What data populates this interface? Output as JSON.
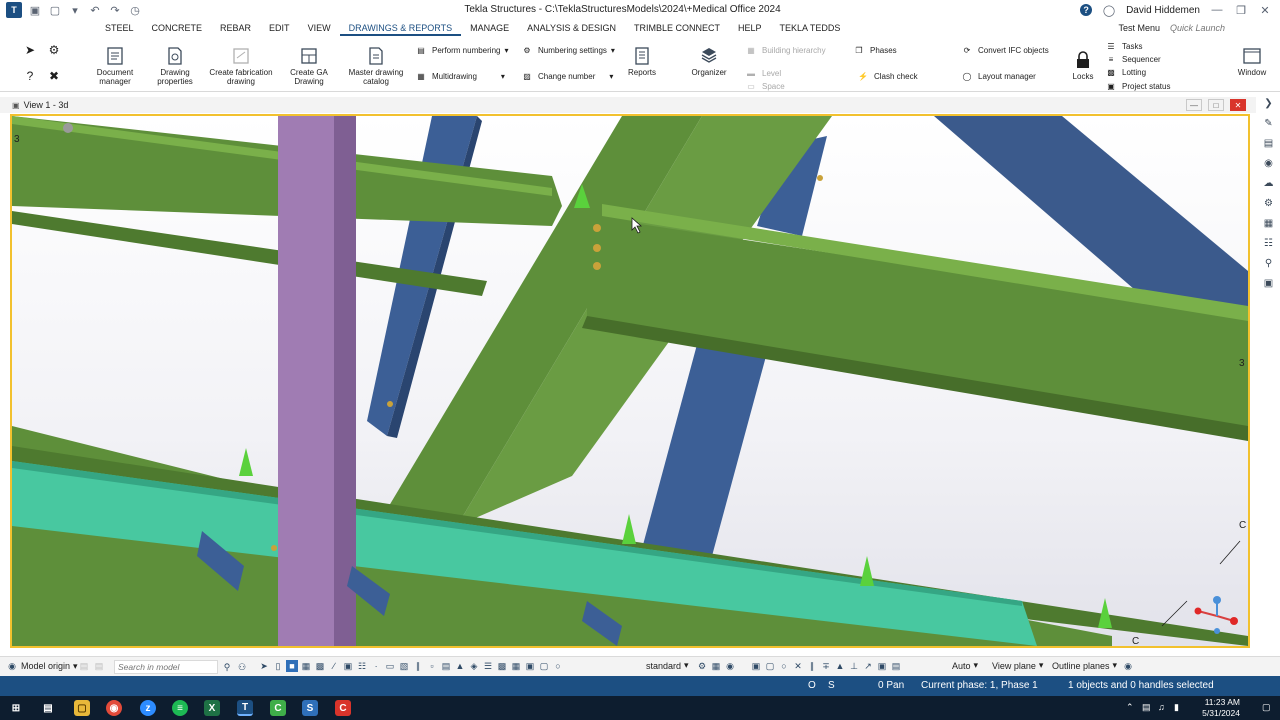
{
  "window": {
    "title": "Tekla Structures - C:\\TeklaStructuresModels\\2024\\+Medical Office 2024",
    "user": "David Hiddemen"
  },
  "menu": {
    "tabs": [
      "STEEL",
      "CONCRETE",
      "REBAR",
      "EDIT",
      "VIEW",
      "DRAWINGS & REPORTS",
      "MANAGE",
      "ANALYSIS & DESIGN",
      "TRIMBLE CONNECT",
      "HELP",
      "TEKLA TEDDS"
    ],
    "active_tab": "DRAWINGS & REPORTS",
    "test_menu": "Test Menu",
    "quick_launch_placeholder": "Quick Launch"
  },
  "ribbon": {
    "document_manager": "Document manager",
    "drawing_properties": "Drawing properties",
    "create_fabrication_drawing": "Create fabrication drawing",
    "create_ga_drawing": "Create GA Drawing",
    "master_drawing_catalog": "Master drawing catalog",
    "perform_numbering": "Perform numbering",
    "numbering_settings": "Numbering settings",
    "multidrawing": "Multidrawing",
    "change_number": "Change number",
    "reports": "Reports",
    "organizer": "Organizer",
    "building_hierarchy": "Building hierarchy",
    "level": "Level",
    "space": "Space",
    "phases": "Phases",
    "clash_check": "Clash check",
    "convert_ifc_objects": "Convert IFC objects",
    "layout_manager": "Layout manager",
    "locks": "Locks",
    "tasks": "Tasks",
    "sequencer": "Sequencer",
    "lotting": "Lotting",
    "project_status": "Project status",
    "window": "Window"
  },
  "view": {
    "title": "View 1 - 3d",
    "grid_labels": [
      "3",
      "3",
      "C",
      "C"
    ]
  },
  "bottom_toolbar": {
    "model_origin": "Model origin",
    "search_placeholder": "Search in model",
    "standard": "standard",
    "auto": "Auto",
    "view_plane": "View plane",
    "outline_planes": "Outline planes"
  },
  "status": {
    "o": "O",
    "s": "S",
    "pan": "0 Pan",
    "phase": "Current phase: 1, Phase 1",
    "selection": "1 objects and 0 handles selected"
  },
  "taskbar": {
    "time": "11:23 AM",
    "date": "5/31/2024"
  },
  "colors": {
    "ribbon_accent": "#1c4f82",
    "beam_green": "#5e8f3a",
    "brace_blue": "#3c5f96",
    "column_purple": "#a07cb3",
    "highlight_teal": "#48c8a0",
    "view_border": "#f2c12e"
  }
}
